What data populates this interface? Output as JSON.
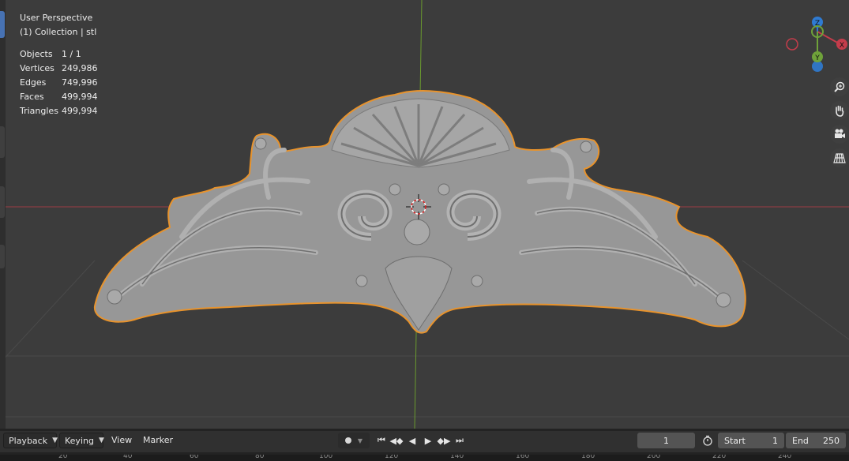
{
  "viewport": {
    "perspective_label": "User Perspective",
    "collection_label": "(1) Collection | stl",
    "stats": [
      {
        "key": "Objects",
        "value": "1 / 1"
      },
      {
        "key": "Vertices",
        "value": "249,986"
      },
      {
        "key": "Edges",
        "value": "749,996"
      },
      {
        "key": "Faces",
        "value": "499,994"
      },
      {
        "key": "Triangles",
        "value": "499,994"
      }
    ],
    "gizmo": {
      "z": "Z",
      "x": "X",
      "y": "Y"
    },
    "colors": {
      "selection_outline": "#e8932c",
      "x_axis": "#c43c4b",
      "y_axis": "#6fa23a",
      "z_axis": "#2f7bd2",
      "mesh": "#9a9a9a"
    },
    "nav_icons": [
      "zoom-icon",
      "pan-hand-icon",
      "camera-icon",
      "grid-view-icon"
    ]
  },
  "timeline": {
    "playback_label": "Playback",
    "keying_label": "Keying",
    "view_label": "View",
    "marker_label": "Marker",
    "current_frame": "1",
    "start_label": "Start",
    "start_value": "1",
    "end_label": "End",
    "end_value": "250",
    "ruler_ticks": [
      "20",
      "40",
      "60",
      "80",
      "100",
      "120",
      "140",
      "160",
      "180",
      "200",
      "220",
      "240"
    ]
  }
}
